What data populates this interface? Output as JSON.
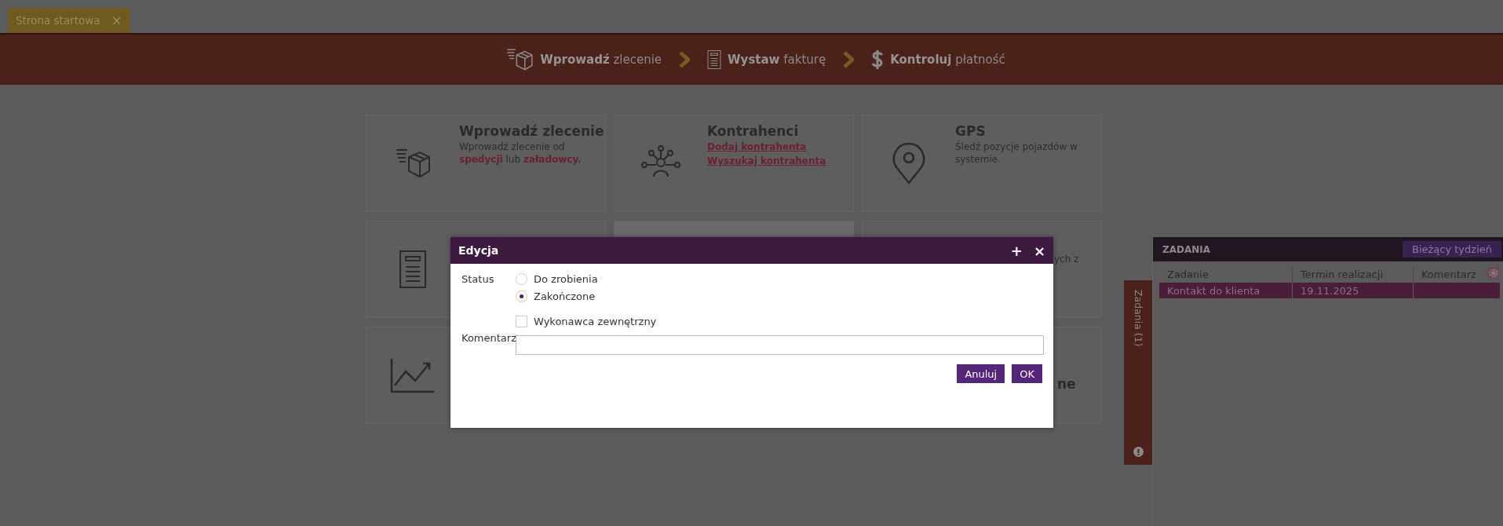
{
  "tabs": [
    {
      "label": "Strona startowa",
      "close": "×",
      "selected": true
    }
  ],
  "workflow": [
    {
      "kind": "box",
      "text": "**Wprowadź** zlecenie"
    },
    {
      "kind": "invoice",
      "text": "**Wystaw** fakturę"
    },
    {
      "kind": "dollar",
      "text": "**Kontroluj** płatność"
    }
  ],
  "tiles": [
    {
      "kind": "box",
      "title": "Wprowadź zlecenie",
      "description": "Wprowadź zlecenie od **spedycji** lub **załadowcy.**",
      "highlighted": false
    },
    {
      "kind": "network",
      "title": "Kontrahenci",
      "links": [
        "Dodaj kontrahenta",
        "Wyszukaj kontrahenta"
      ],
      "highlighted": false
    },
    {
      "kind": "pin",
      "title": "GPS",
      "description": "Śledź pozycje pojazdów w systemie.",
      "highlighted": false
    },
    {
      "kind": "invoice",
      "highlighted": false
    },
    {
      "kind": "none",
      "highlighted": true
    },
    {
      "kind": "none",
      "description": "ych z",
      "highlighted": false
    },
    {
      "kind": "chart",
      "highlighted": false
    },
    {
      "kind": "none",
      "title": "ne",
      "highlighted": false
    }
  ],
  "dialog": {
    "title": "Edycja",
    "actions": [
      "+",
      "×"
    ],
    "status_label": "Status",
    "status_options": [
      {
        "label": "Do zrobienia",
        "selected": false
      },
      {
        "label": "Zakończone",
        "selected": true
      }
    ],
    "external": {
      "label": "Wykonawca zewnętrzny",
      "checked": false
    },
    "comment_label": "Komentarz",
    "buttons": [
      "Anuluj",
      "OK"
    ]
  },
  "side_tab": {
    "label": "Zadania (1)"
  },
  "tasks": {
    "title": "ZADANIA",
    "filter": "Bieżący tydzień",
    "columns": [
      "Zadanie",
      "Termin realizacji",
      "Komentarz"
    ],
    "rows": [
      {
        "cells": [
          "Kontakt do klienta",
          "19.11.2025"
        ],
        "selected": true
      }
    ]
  }
}
